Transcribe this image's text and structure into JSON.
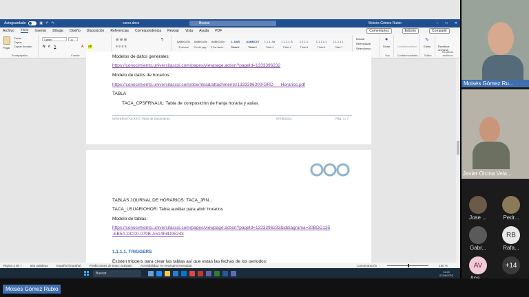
{
  "titlebar": {
    "autosave_label": "Autoguardado",
    "doc_name": "curso.docx",
    "search_placeholder": "Buscar",
    "user_name": "Moisés Gómez Rubio"
  },
  "tabs": [
    "Archivo",
    "Inicio",
    "Insertar",
    "Dibujar",
    "Diseño",
    "Disposición",
    "Referencias",
    "Correspondencia",
    "Revisar",
    "Vista",
    "Ayuda",
    "PDF"
  ],
  "tab_right": {
    "comments": "Comentarios",
    "editing": "Edición",
    "share": "Compartir"
  },
  "ribbon": {
    "paste_label": "Pegar",
    "cut_label": "Cortar",
    "copy_label": "Copiar",
    "format_label": "Copiar formato",
    "font_name": "Calibri",
    "font_size": "11",
    "styles": [
      {
        "preview": "AaBbCcDc",
        "name": "¶ Normal"
      },
      {
        "preview": "AaBbCcDc",
        "name": "Par de pag..."
      },
      {
        "preview": "AaBbCcDc",
        "name": "¶ Par decis..."
      },
      {
        "preview": "1. AAB",
        "name": "Título 1"
      },
      {
        "preview": "AABBCCI",
        "name": "Título 2"
      },
      {
        "preview": "1.1.1. Aa",
        "name": "Título 3"
      },
      {
        "preview": "1.1.1.1. A",
        "name": "Título 4"
      },
      {
        "preview": "1.1.1.1.",
        "name": "Título 5"
      },
      {
        "preview": "1.1.1.1.1",
        "name": "Título 6"
      },
      {
        "preview": "1.1.1.1.1.",
        "name": "Título 7"
      }
    ],
    "find_label": "Buscar",
    "replace_label": "Reemplazar",
    "select_label": "Seleccionar",
    "dictate_label": "Dictar",
    "sensitivity_label": "Confidencialidad",
    "editor_label": "Editor",
    "reuse_label": "Reutilizar archivos",
    "group_labels": [
      "Portapapeles",
      "Fuente",
      "Párrafo",
      "Estilos",
      "Edición",
      "Voz",
      "Confidencialidad",
      "Editor",
      "Reutilizar archivos"
    ]
  },
  "page1": {
    "cut_heading": "Modelos de datos generales:",
    "link1": "https://conocimiento.universitasxxi.com/pages/viewpage.action?pageId=1333396232",
    "label_horarios": "Modelo de datos de horarios:",
    "link2": "https://conocimiento.universitasxxi.com/download/attachments/1333396300/GRD___Horarios.pdf",
    "tabla_label": "TABLA",
    "tabla_desc": "TACA_CPSFRNAUL: Tabla de composición de franja horaria y aulas.",
    "footer_left": "UNIVERSITAS XXI | Título de Documento",
    "footer_date": "07/06/2023",
    "footer_page": "Pág. 3 / 7"
  },
  "page2": {
    "line1": "TABLAS JOURNAL DE HORARIOS: TACA_JRN...",
    "line2": "TACA_USUARIOHOR: Tabla auxiliar para abrir horarios",
    "line3": "Modelo de tablas:",
    "link3a": "https://conocimiento.universitasxxi.com/pages/viewpage.action?pageId=1333396233&iddiagrama=30BDD135",
    "link3b": "-EB5A-DCD0-079B-A514F8D95243",
    "heading": "1.1.1.1.  TRIGGERS",
    "cut_text": "Existen triggers para crear las tablas así que estas las fechas de los periodos:"
  },
  "statusbar": {
    "page": "Página 3 de 7",
    "words": "553 palabras",
    "lang": "Español (España)",
    "predictions": "Predicciones de texto: activado",
    "accessibility": "Accesibilidad: es necesario investigar",
    "focus": "Concentración",
    "zoom": "100 %"
  },
  "taskbar": {
    "search": "Buscar",
    "time": "11:20",
    "date": "07/06/2023"
  },
  "participants": {
    "main1": "Moisés Gómez Ru...",
    "main2": "Javier Olcina Vela...",
    "thumbs": [
      {
        "name": "Jose ...",
        "initials": "",
        "color": "#6a5a4a"
      },
      {
        "name": "Pedr...",
        "initials": "",
        "color": "#8a7a5a"
      },
      {
        "name": "Gabr...",
        "initials": "",
        "color": "#5a5a5a"
      },
      {
        "name": "Rafa...",
        "initials": "RB",
        "color": "#e8e8e8"
      },
      {
        "name": "Ana ...",
        "initials": "AV",
        "color": "#f2c9d6"
      },
      {
        "name": "",
        "initials": "+14",
        "color": "#3a3a3a"
      }
    ]
  },
  "speaker_label": "Moisés Gómez Rubio"
}
